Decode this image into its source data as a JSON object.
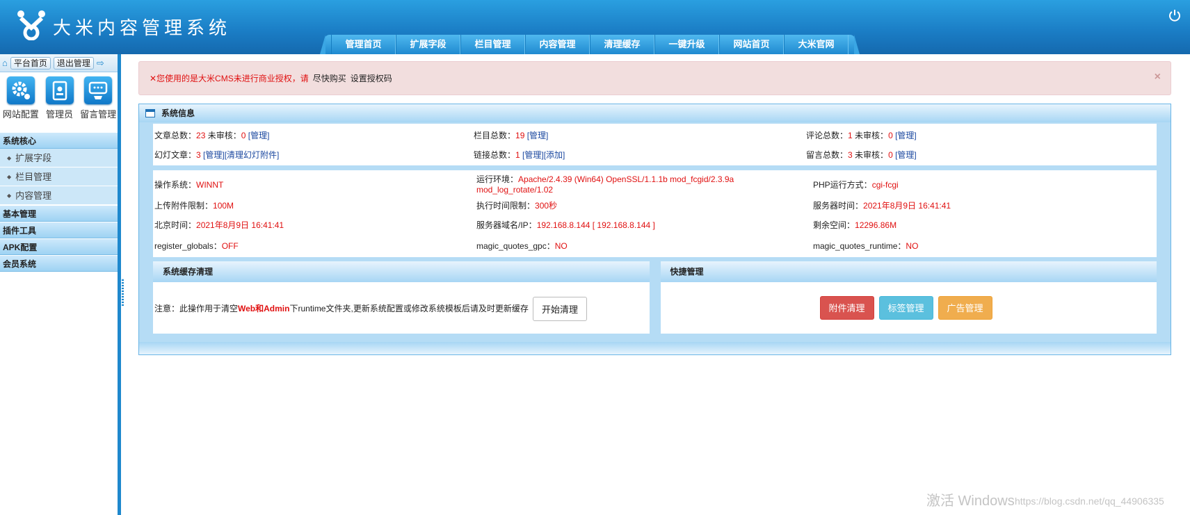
{
  "header": {
    "title": "大米内容管理系统",
    "nav": [
      "管理首页",
      "扩展字段",
      "栏目管理",
      "内容管理",
      "清理缓存",
      "一键升级",
      "网站首页",
      "大米官网"
    ]
  },
  "sidebar": {
    "top_buttons": [
      "平台首页",
      "退出管理"
    ],
    "quick": [
      "网站配置",
      "管理员",
      "留言管理"
    ],
    "sections": [
      {
        "title": "系统核心",
        "items": [
          "扩展字段",
          "栏目管理",
          "内容管理"
        ]
      },
      {
        "title": "基本管理"
      },
      {
        "title": "插件工具"
      },
      {
        "title": "APK配置"
      },
      {
        "title": "会员系统"
      }
    ]
  },
  "alert": {
    "close": "×",
    "warning": "✕您使用的是大米CMS未进行商业授权，请",
    "buy": "尽快购买",
    "code": "设置授权码"
  },
  "panel": {
    "title": "系统信息",
    "articles_label": "文章总数：",
    "articles": "23",
    "unreviewed_label": "未审核：",
    "articles_unreviewed": "0",
    "manage": "[管理]",
    "columns_label": "栏目总数：",
    "columns": "19",
    "comments_label": "评论总数：",
    "comments": "1",
    "comments_unreviewed": "0",
    "slides_label": "幻灯文章：",
    "slides": "3",
    "slide_clean": "][清理幻灯附件]",
    "slide_manage": "[管理",
    "links_label": "链接总数：",
    "links": "1",
    "add": "[添加]",
    "messages_label": "留言总数：",
    "messages": "3",
    "messages_unreviewed": "0",
    "os_label": "操作系统：",
    "os": "WINNT",
    "runtime_label": "运行环境：",
    "runtime_1": "Apache/2.4.39 (Win64) OpenSSL/1.1.1b mod_fcgid/2.3.9a",
    "runtime_2": "mod_log_rotate/1.02",
    "php_label": "PHP运行方式：",
    "php": "cgi-fcgi",
    "upload_label": "上传附件限制：",
    "upload": "100M",
    "exec_label": "执行时间限制：",
    "exec": "300秒",
    "server_time_label": "服务器时间：",
    "server_time": "2021年8月9日 16:41:41",
    "bj_time_label": "北京时间：",
    "bj_time": "2021年8月9日 16:41:41",
    "domain_label": "服务器域名/IP：",
    "domain": "192.168.8.144 [ 192.168.8.144 ]",
    "space_label": "剩余空间：",
    "space": "12296.86M",
    "rg_label": "register_globals：",
    "rg": "OFF",
    "mqg_label": "magic_quotes_gpc：",
    "mqg": "NO",
    "mqr_label": "magic_quotes_runtime：",
    "mqr": "NO"
  },
  "cache": {
    "title": "系统缓存清理",
    "note_a": "注意：此操作用于清空",
    "note_b": "Web和Admin",
    "note_c": "下runtime文件夹,更新系统配置或修改系统模板后请及时更新缓存",
    "button": "开始清理"
  },
  "quick_manage": {
    "title": "快捷管理",
    "buttons": [
      "附件清理",
      "标签管理",
      "广告管理"
    ]
  },
  "watermark": {
    "text": "激活 Windows",
    "url": "https://blog.csdn.net/qq_44906335"
  },
  "colors": {
    "header": "#1a7cc4",
    "danger": "#d9534f",
    "info": "#5bc0de",
    "warning": "#f0ad4e",
    "alert_bg": "#f2dede"
  }
}
